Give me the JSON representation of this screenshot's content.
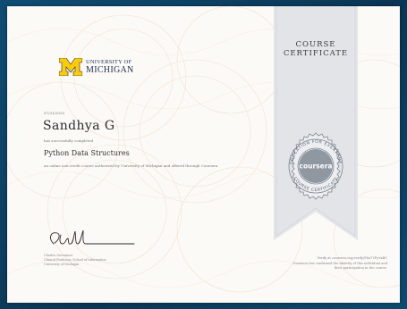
{
  "issuer": {
    "univ_line": "UNIVERSITY OF",
    "name_line": "MICHIGAN"
  },
  "certificate": {
    "date": "07/31/2020",
    "recipient": "Sandhya G",
    "completed_text": "has successfully completed",
    "course_title": "Python Data Structures",
    "description": "an online non-credit course authorized by University of Michigan and offered through Coursera"
  },
  "signatory": {
    "name": "Charles Severance",
    "title": "Clinical Professor, School of Information",
    "org": "University of Michigan"
  },
  "ribbon": {
    "line1": "COURSE",
    "line2": "CERTIFICATE"
  },
  "seal": {
    "brand": "coursera",
    "ring_top": "EDUCATION FOR EVERYONE",
    "ring_bottom": "COURSE CERTIFICATE"
  },
  "verification": {
    "line1": "Verify at coursera.org/verify/P6a7YFy3xBC",
    "line2": "Coursera has confirmed the identity of this individual and",
    "line3": "their participation in the course."
  },
  "colors": {
    "michigan_maize": "#ffcb05",
    "michigan_blue": "#1e2f57",
    "ribbon": "#e2e4e8",
    "seal_center": "#8f97a1",
    "frame": "#0b3d5c"
  }
}
